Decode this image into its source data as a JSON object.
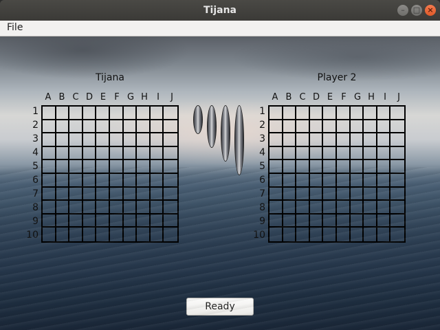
{
  "window": {
    "title": "Tijana",
    "buttons": {
      "minimize": "–",
      "maximize": "□",
      "close": "×"
    }
  },
  "menubar": {
    "file": "File"
  },
  "columns": [
    "A",
    "B",
    "C",
    "D",
    "E",
    "F",
    "G",
    "H",
    "I",
    "J"
  ],
  "rows": [
    "1",
    "2",
    "3",
    "4",
    "5",
    "6",
    "7",
    "8",
    "9",
    "10"
  ],
  "boards": {
    "left": {
      "title": "Tijana"
    },
    "right": {
      "title": "Player 2"
    }
  },
  "ships": [
    {
      "name": "ship-size-2",
      "length": 2
    },
    {
      "name": "ship-size-3",
      "length": 3
    },
    {
      "name": "ship-size-4",
      "length": 4
    },
    {
      "name": "ship-size-5",
      "length": 5
    }
  ],
  "ready_button": "Ready"
}
